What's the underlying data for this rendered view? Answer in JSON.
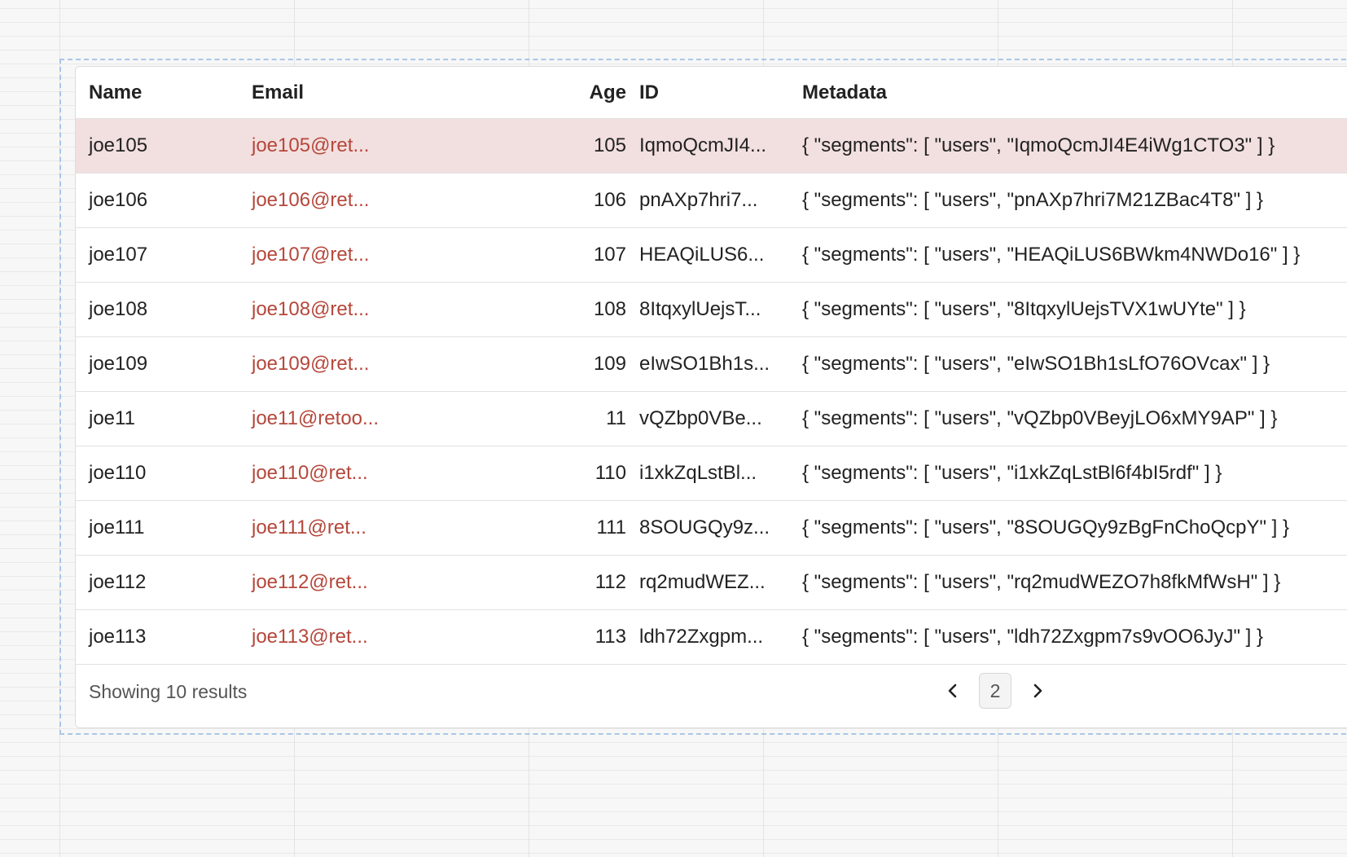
{
  "table": {
    "columns": [
      "Name",
      "Email",
      "Age",
      "ID",
      "Metadata"
    ],
    "rows": [
      {
        "name": "joe105",
        "email": "joe105@ret...",
        "age": "105",
        "id": "IqmoQcmJI4...",
        "metadata": "{ \"segments\": [ \"users\", \"IqmoQcmJI4E4iWg1CTO3\" ] }"
      },
      {
        "name": "joe106",
        "email": "joe106@ret...",
        "age": "106",
        "id": "pnAXp7hri7...",
        "metadata": "{ \"segments\": [ \"users\", \"pnAXp7hri7M21ZBac4T8\" ] }"
      },
      {
        "name": "joe107",
        "email": "joe107@ret...",
        "age": "107",
        "id": "HEAQiLUS6...",
        "metadata": "{ \"segments\": [ \"users\", \"HEAQiLUS6BWkm4NWDo16\" ] }"
      },
      {
        "name": "joe108",
        "email": "joe108@ret...",
        "age": "108",
        "id": "8ItqxylUejsT...",
        "metadata": "{ \"segments\": [ \"users\", \"8ItqxylUejsTVX1wUYte\" ] }"
      },
      {
        "name": "joe109",
        "email": "joe109@ret...",
        "age": "109",
        "id": "eIwSO1Bh1s...",
        "metadata": "{ \"segments\": [ \"users\", \"eIwSO1Bh1sLfO76OVcax\" ] }"
      },
      {
        "name": "joe11",
        "email": "joe11@retoo...",
        "age": "11",
        "id": "vQZbp0VBe...",
        "metadata": "{ \"segments\": [ \"users\", \"vQZbp0VBeyjLO6xMY9AP\" ] }"
      },
      {
        "name": "joe110",
        "email": "joe110@ret...",
        "age": "110",
        "id": "i1xkZqLstBl...",
        "metadata": "{ \"segments\": [ \"users\", \"i1xkZqLstBl6f4bI5rdf\" ] }"
      },
      {
        "name": "joe111",
        "email": "joe111@ret...",
        "age": "111",
        "id": "8SOUGQy9z...",
        "metadata": "{ \"segments\": [ \"users\", \"8SOUGQy9zBgFnChoQcpY\" ] }"
      },
      {
        "name": "joe112",
        "email": "joe112@ret...",
        "age": "112",
        "id": "rq2mudWEZ...",
        "metadata": "{ \"segments\": [ \"users\", \"rq2mudWEZO7h8fkMfWsH\" ] }"
      },
      {
        "name": "joe113",
        "email": "joe113@ret...",
        "age": "113",
        "id": "ldh72Zxgpm...",
        "metadata": "{ \"segments\": [ \"users\", \"ldh72Zxgpm7s9vOO6JyJ\" ] }"
      }
    ],
    "selected_row_color": "#f2dfdf",
    "email_link_color": "#b5473b"
  },
  "footer": {
    "results_text": "Showing 10 results",
    "current_page": "2",
    "prev_icon": "chevron-left-icon",
    "next_icon": "chevron-right-icon"
  }
}
